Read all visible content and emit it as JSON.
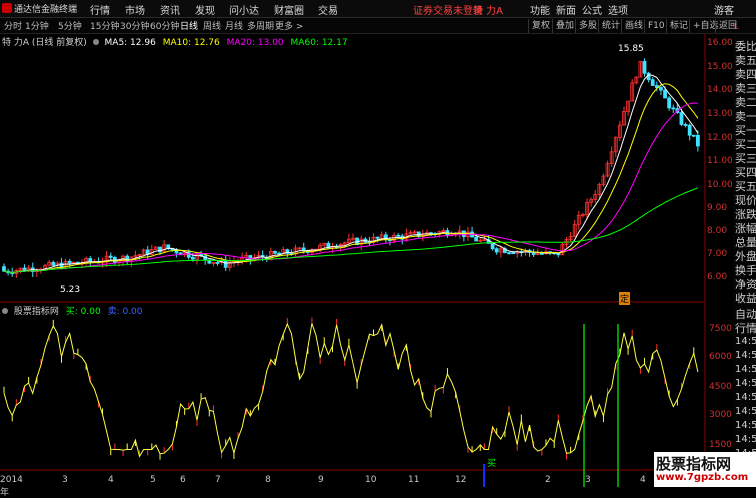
{
  "app": {
    "title": "通达信金融终端",
    "menu": [
      "行情",
      "市场",
      "资讯",
      "发现",
      "问小达",
      "财富圈",
      "交易"
    ],
    "center_text": "证券交易未登录",
    "stock_short": "特 力A",
    "right_menu": [
      "功能",
      "新面",
      "公式",
      "选项"
    ],
    "user": "游客"
  },
  "periods": [
    "分时",
    "1分钟",
    "5分钟",
    "15分钟",
    "30分钟",
    "60分钟",
    "日线",
    "周线",
    "月线",
    "多周期",
    "更多 >"
  ],
  "active_period": "日线",
  "toolbar_right": [
    "复权",
    "叠加",
    "多股",
    "统计",
    "画线",
    "F10",
    "标记",
    "+自选",
    "返回"
  ],
  "main_chart": {
    "stock_label": "特 力A (日线 前复权)",
    "ma": [
      {
        "label": "MA5: 12.96",
        "color": "#ffffff"
      },
      {
        "label": "MA10: 12.76",
        "color": "#ffff00"
      },
      {
        "label": "MA20: 13.00",
        "color": "#ff00ff"
      },
      {
        "label": "MA60: 12.17",
        "color": "#00ff00"
      }
    ],
    "high_label": "15.85",
    "low_label": "5.23",
    "ding_label": "定"
  },
  "y_axis_main": [
    "16.00",
    "15.00",
    "14.00",
    "13.00",
    "12.00",
    "11.00",
    "10.00",
    "9.00",
    "8.00",
    "7.00",
    "6.00"
  ],
  "indicator": {
    "name": "股票指标网",
    "buy_label": "买: 0.00",
    "sell_label": "卖: 0.00",
    "mark_label": "买"
  },
  "y_axis_indicator": [
    "7500",
    "6000",
    "4500",
    "3000",
    "1500"
  ],
  "x_axis": [
    "2014年",
    "3",
    "4",
    "5",
    "6",
    "7",
    "8",
    "9",
    "10",
    "11",
    "12",
    "2",
    "3",
    "4"
  ],
  "side_labels": [
    "委比",
    "卖五",
    "卖四",
    "卖三",
    "卖二",
    "卖一",
    "买一",
    "买二",
    "买三",
    "买四",
    "买五",
    "现价",
    "涨跌",
    "涨幅",
    "总量",
    "外盘",
    "换手",
    "净资",
    "收益",
    "自动",
    "行情",
    "14:5",
    "14:5",
    "14:5",
    "14:5",
    "14:5",
    "14:5",
    "14:5",
    "14:5",
    "14:5"
  ],
  "watermark": {
    "line1": "股票指标网",
    "line2": "www.7gpzb.com"
  },
  "colors": {
    "up": "#ff3030",
    "down": "#40e0ff",
    "ma5": "#ffffff",
    "ma10": "#ffff00",
    "ma20": "#ff00ff",
    "ma60": "#00ff00",
    "indicator": "#ffff40",
    "axis": "#d03030"
  }
}
